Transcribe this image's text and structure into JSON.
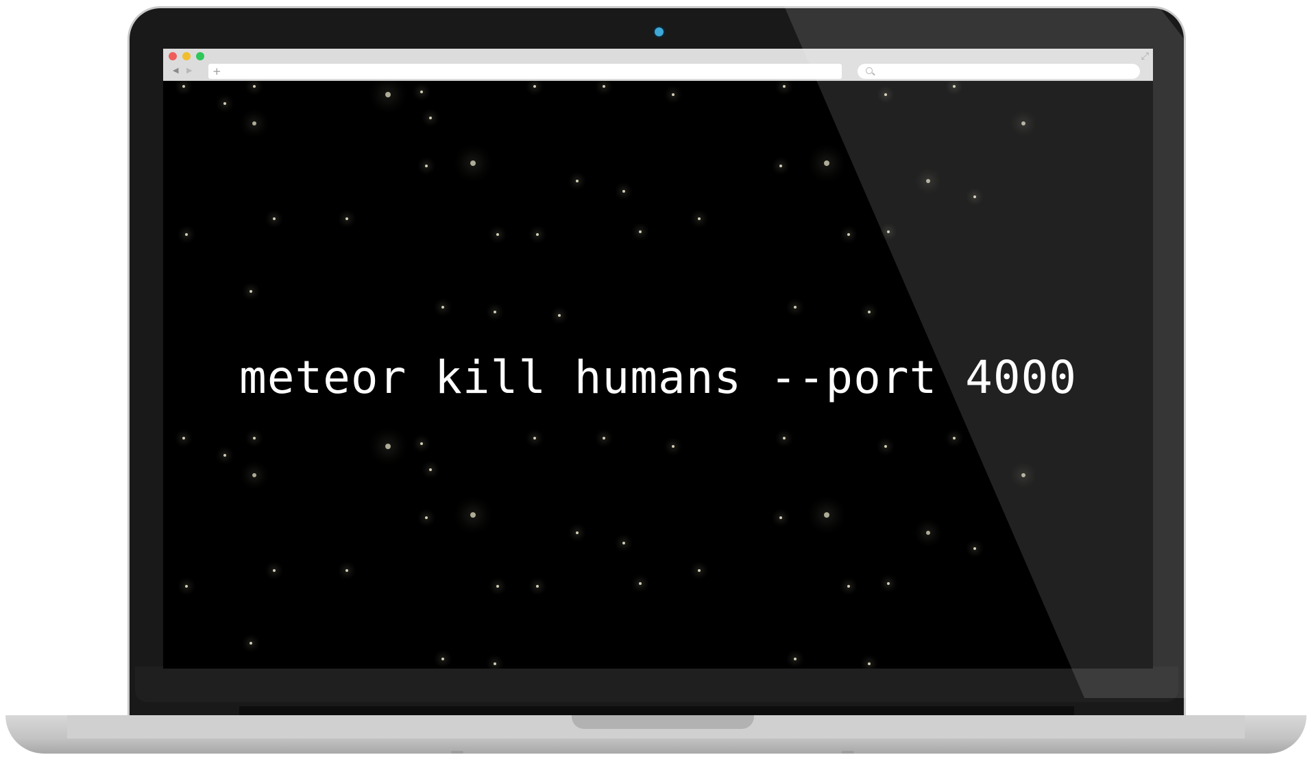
{
  "browser": {
    "back_icon": "◀",
    "forward_icon": "▶",
    "new_tab_icon": "+",
    "fullscreen_icon": "⤢"
  },
  "page": {
    "hero_text": "meteor kill humans --port 4000"
  },
  "colors": {
    "screen_background": "#000000",
    "star_color": "#e8e4c8",
    "webcam": "#3fa8d6"
  }
}
